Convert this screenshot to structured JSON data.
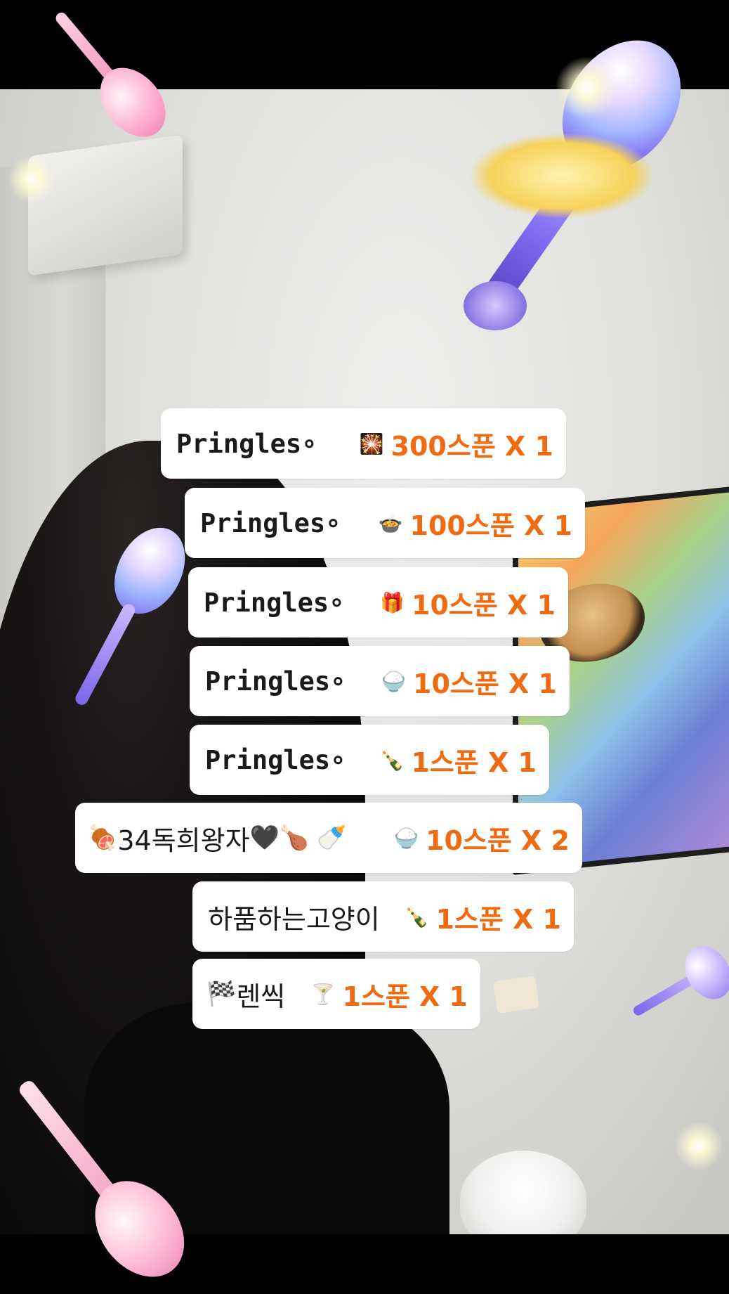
{
  "entries": [
    {
      "name": "Pringles∘",
      "gift_icon": "🎇",
      "gift_icon_name": "sparkler-icon",
      "amount": "300스푼 X 1"
    },
    {
      "name": "Pringles∘",
      "gift_icon": "🍲",
      "gift_icon_name": "stew-pot-icon",
      "amount": "100스푼 X 1"
    },
    {
      "name": "Pringles∘",
      "gift_icon": "🎁",
      "gift_icon_name": "gift-box-icon",
      "amount": "10스푼 X 1"
    },
    {
      "name": "Pringles∘",
      "gift_icon": "🍚",
      "gift_icon_name": "rice-bowl-icon",
      "amount": "10스푼 X 1"
    },
    {
      "name": "Pringles∘",
      "gift_icon": "🍾",
      "gift_icon_name": "soju-bottle-icon",
      "amount": "1스푼 X 1"
    },
    {
      "name_prefix_icon": "🍖",
      "name_prefix_icon_name": "meat-on-bone-icon",
      "name": "34독희왕자",
      "name_suffix_icons": "🖤🍗 🍼",
      "name_suffix_icon_names": "black-heart-icon chicken-leg-icon baby-bottle-icon",
      "gift_icon": "🍚",
      "gift_icon_name": "rice-bowl-icon",
      "amount": "10스푼 X 2"
    },
    {
      "name": "하품하는고양이",
      "gift_icon": "🍾",
      "gift_icon_name": "soju-bottle-icon",
      "amount": "1스푼 X 1"
    },
    {
      "name_prefix_icon": "🏁",
      "name_prefix_icon_name": "checkered-flag-icon",
      "name": "렌씩",
      "gift_icon": "🍸",
      "gift_icon_name": "cocktail-glass-icon",
      "amount": "1스푼 X 1"
    }
  ],
  "colors": {
    "amount": "#f06a12",
    "card_bg": "#ffffff",
    "name_text": "#1a1a1a"
  }
}
